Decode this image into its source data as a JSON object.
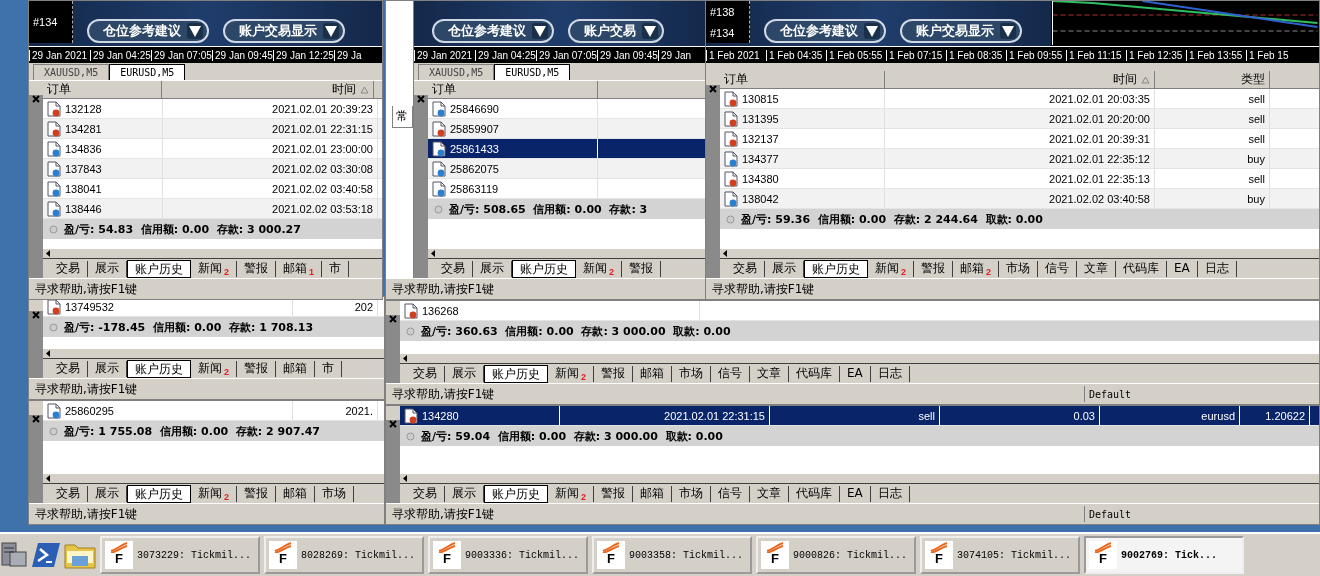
{
  "windows": [
    {
      "chart": {
        "kind": "panel",
        "tags": [
          "#134"
        ],
        "buttons": [
          "仓位参考建议",
          "账户交易显示"
        ],
        "axis": [
          "29 Jan 2021",
          "29 Jan 04:25",
          "29 Jan 07:05",
          "29 Jan 09:45",
          "29 Jan 12:25",
          "29 Ja"
        ]
      },
      "chart_tabs": [
        {
          "label": "XAUUSD,M5",
          "selected": false
        },
        {
          "label": "EURUSD,M5",
          "selected": true
        }
      ],
      "table": {
        "columns": [
          {
            "label": "订单",
            "sorted": false
          },
          {
            "label": "时间",
            "sorted": true
          }
        ],
        "rows": [
          {
            "cells": [
              "132128",
              "2021.02.01 20:39:23"
            ],
            "color": "#d04020",
            "selected": false
          },
          {
            "cells": [
              "134281",
              "2021.02.01 22:31:15"
            ],
            "color": "#d04020",
            "selected": false
          },
          {
            "cells": [
              "134836",
              "2021.02.01 23:00:00"
            ],
            "color": "#2a7fd0",
            "selected": false
          },
          {
            "cells": [
              "137843",
              "2021.02.02 03:30:08"
            ],
            "color": "#2a7fd0",
            "selected": false
          },
          {
            "cells": [
              "138041",
              "2021.02.02 03:40:58"
            ],
            "color": "#2a7fd0",
            "selected": false
          },
          {
            "cells": [
              "138446",
              "2021.02.02 03:53:18"
            ],
            "color": "#2a7fd0",
            "selected": false
          }
        ]
      },
      "summary": "盈/亏: 54.83  信用额: 0.00  存款: 3 000.27",
      "tabs": [
        {
          "label": "交易",
          "selected": false
        },
        {
          "label": "展示",
          "selected": false
        },
        {
          "label": "账户历史",
          "selected": true
        },
        {
          "label": "新闻",
          "badge": "2",
          "selected": false
        },
        {
          "label": "警报",
          "selected": false
        },
        {
          "label": "邮箱",
          "badge": "1",
          "selected": false
        },
        {
          "label": "市",
          "selected": false
        }
      ],
      "status": {
        "text": "寻求帮助,请按F1键"
      }
    },
    {
      "side_tab": "常",
      "chart": {
        "kind": "panel",
        "buttons": [
          "仓位参考建议",
          "账户交易"
        ],
        "axis": [
          "29 Jan 2021",
          "29 Jan 04:25",
          "29 Jan 07:05",
          "29 Jan 09:45",
          "29 Jan"
        ]
      },
      "chart_tabs": [
        {
          "label": "XAUUSD,M5",
          "selected": false
        },
        {
          "label": "EURUSD,M5",
          "selected": true
        }
      ],
      "table": {
        "columns": [
          {
            "label": "订单",
            "sorted": false
          }
        ],
        "rows": [
          {
            "cells": [
              "25846690"
            ],
            "color": "#2a7fd0",
            "selected": false
          },
          {
            "cells": [
              "25859907"
            ],
            "color": "#d04020",
            "selected": false
          },
          {
            "cells": [
              "25861433"
            ],
            "color": "#2a7fd0",
            "selected": true
          },
          {
            "cells": [
              "25862075"
            ],
            "color": "#2a7fd0",
            "selected": false
          },
          {
            "cells": [
              "25863119"
            ],
            "color": "#2a7fd0",
            "selected": false
          }
        ]
      },
      "summary": "盈/亏: 508.65  信用额: 0.00  存款: 3",
      "tabs": [
        {
          "label": "交易",
          "selected": false
        },
        {
          "label": "展示",
          "selected": false
        },
        {
          "label": "账户历史",
          "selected": true
        },
        {
          "label": "新闻",
          "badge": "2",
          "selected": false
        },
        {
          "label": "警报",
          "selected": false
        }
      ],
      "status": {
        "text": "寻求帮助,请按F1键"
      }
    },
    {
      "chart": {
        "kind": "split",
        "tags": [
          "#138",
          "#134"
        ],
        "buttons": [
          "仓位参考建议",
          "账户交易显示"
        ],
        "axis": [
          "1 Feb 2021",
          "1 Feb 04:35",
          "1 Feb 05:55",
          "1 Feb 07:15",
          "1 Feb 08:35",
          "1 Feb 09:55",
          "1 Feb 11:15",
          "1 Feb 12:35",
          "1 Feb 13:55",
          "1 Feb 15"
        ]
      },
      "table": {
        "columns": [
          {
            "label": "订单",
            "sorted": false
          },
          {
            "label": "时间",
            "sorted": true
          },
          {
            "label": "类型",
            "sorted": false
          }
        ],
        "rows": [
          {
            "cells": [
              "130815",
              "2021.02.01 20:03:35",
              "sell"
            ],
            "color": "#d04020",
            "selected": false
          },
          {
            "cells": [
              "131395",
              "2021.02.01 20:20:00",
              "sell"
            ],
            "color": "#d04020",
            "selected": false
          },
          {
            "cells": [
              "132137",
              "2021.02.01 20:39:31",
              "sell"
            ],
            "color": "#d04020",
            "selected": false
          },
          {
            "cells": [
              "134377",
              "2021.02.01 22:35:12",
              "buy"
            ],
            "color": "#2a7fd0",
            "selected": false
          },
          {
            "cells": [
              "134380",
              "2021.02.01 22:35:13",
              "sell"
            ],
            "color": "#d04020",
            "selected": false
          },
          {
            "cells": [
              "138042",
              "2021.02.02 03:40:58",
              "buy"
            ],
            "color": "#2a7fd0",
            "selected": false
          }
        ]
      },
      "summary": "盈/亏: 59.36  信用额: 0.00  存款: 2 244.64  取款: 0.00",
      "tabs": [
        {
          "label": "交易",
          "selected": false
        },
        {
          "label": "展示",
          "selected": false
        },
        {
          "label": "账户历史",
          "selected": true
        },
        {
          "label": "新闻",
          "badge": "2",
          "selected": false
        },
        {
          "label": "警报",
          "selected": false
        },
        {
          "label": "邮箱",
          "badge": "2",
          "selected": false
        },
        {
          "label": "市场",
          "selected": false
        },
        {
          "label": "信号",
          "selected": false
        },
        {
          "label": "文章",
          "selected": false
        },
        {
          "label": "代码库",
          "selected": false
        },
        {
          "label": "EA",
          "selected": false
        },
        {
          "label": "日志",
          "selected": false
        }
      ],
      "status": {
        "text": "寻求帮助,请按F1键"
      }
    },
    {
      "table": {
        "rows": [
          {
            "cells": [
              "13749532",
              "202"
            ],
            "color": "#d04020",
            "selected": false
          }
        ]
      },
      "summary": "盈/亏: -178.45  信用额: 0.00  存款: 1 708.13",
      "tabs": [
        {
          "label": "交易",
          "selected": false
        },
        {
          "label": "展示",
          "selected": false
        },
        {
          "label": "账户历史",
          "selected": true
        },
        {
          "label": "新闻",
          "badge": "2",
          "selected": false
        },
        {
          "label": "警报",
          "selected": false
        },
        {
          "label": "邮箱",
          "selected": false
        },
        {
          "label": "市",
          "selected": false
        }
      ],
      "status": {
        "text": "寻求帮助,请按F1键"
      }
    },
    {
      "table": {
        "rows": [
          {
            "cells": [
              "136268"
            ],
            "color": "#d04020",
            "selected": false
          }
        ]
      },
      "summary": "盈/亏: 360.63  信用额: 0.00  存款: 3 000.00  取款: 0.00",
      "tabs": [
        {
          "label": "交易",
          "selected": false
        },
        {
          "label": "展示",
          "selected": false
        },
        {
          "label": "账户历史",
          "selected": true
        },
        {
          "label": "新闻",
          "badge": "2",
          "selected": false
        },
        {
          "label": "警报",
          "selected": false
        },
        {
          "label": "邮箱",
          "selected": false
        },
        {
          "label": "市场",
          "selected": false
        },
        {
          "label": "信号",
          "selected": false
        },
        {
          "label": "文章",
          "selected": false
        },
        {
          "label": "代码库",
          "selected": false
        },
        {
          "label": "EA",
          "selected": false
        },
        {
          "label": "日志",
          "selected": false
        }
      ],
      "status": {
        "text": "寻求帮助,请按F1键",
        "panes": [
          "Default"
        ]
      }
    },
    {
      "table": {
        "rows": [
          {
            "cells": [
              "25860295",
              "2021."
            ],
            "color": "#2a7fd0",
            "selected": false
          }
        ]
      },
      "summary": "盈/亏: 1 755.08  信用额: 0.00  存款: 2 907.47",
      "tabs": [
        {
          "label": "交易",
          "selected": false
        },
        {
          "label": "展示",
          "selected": false
        },
        {
          "label": "账户历史",
          "selected": true
        },
        {
          "label": "新闻",
          "badge": "2",
          "selected": false
        },
        {
          "label": "警报",
          "selected": false
        },
        {
          "label": "邮箱",
          "selected": false
        },
        {
          "label": "市场",
          "selected": false
        }
      ],
      "status": {
        "text": "寻求帮助,请按F1键"
      }
    },
    {
      "table": {
        "rows": [
          {
            "cells": [
              "134280",
              "2021.02.01 22:31:15",
              "sell",
              "0.03",
              "eurusd",
              "1.20622"
            ],
            "color": "#d04020",
            "selected": true
          }
        ]
      },
      "summary": "盈/亏: 59.04  信用额: 0.00  存款: 3 000.00  取款: 0.00",
      "tabs": [
        {
          "label": "交易",
          "selected": false
        },
        {
          "label": "展示",
          "selected": false
        },
        {
          "label": "账户历史",
          "selected": true
        },
        {
          "label": "新闻",
          "badge": "2",
          "selected": false
        },
        {
          "label": "警报",
          "selected": false
        },
        {
          "label": "邮箱",
          "selected": false
        },
        {
          "label": "市场",
          "selected": false
        },
        {
          "label": "信号",
          "selected": false
        },
        {
          "label": "文章",
          "selected": false
        },
        {
          "label": "代码库",
          "selected": false
        },
        {
          "label": "EA",
          "selected": false
        },
        {
          "label": "日志",
          "selected": false
        }
      ],
      "status": {
        "text": "寻求帮助,请按F1键",
        "panes": [
          "Default"
        ]
      }
    }
  ],
  "taskbar": {
    "items": [
      {
        "label": "3073229: Tickmil...",
        "logo": "F",
        "selected": false
      },
      {
        "label": "8028269: Tickmil...",
        "logo": "F",
        "selected": false
      },
      {
        "label": "9003336: Tickmil...",
        "logo": "F",
        "selected": false
      },
      {
        "label": "9003358: Tickmil...",
        "logo": "F",
        "selected": false
      },
      {
        "label": "9000826: Tickmil...",
        "logo": "F",
        "selected": false
      },
      {
        "label": "3074105: Tickmil...",
        "logo": "F",
        "selected": false
      },
      {
        "label": "9002769: Tick...",
        "logo": "F",
        "selected": true
      }
    ]
  }
}
